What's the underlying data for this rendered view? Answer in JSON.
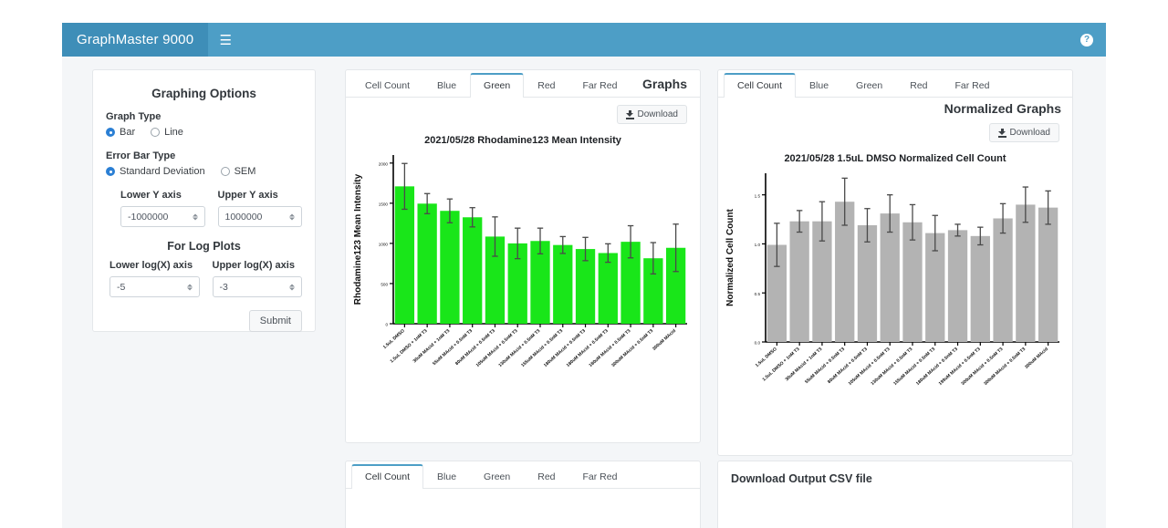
{
  "navbar": {
    "brand": "GraphMaster 9000",
    "menu_icon": "hamburger-icon",
    "help_icon": "?",
    "bg_color": "#4d9ec6",
    "brand_bg_color": "#3e8eb8"
  },
  "options_panel": {
    "title": "Graphing Options",
    "graph_type": {
      "label": "Graph Type",
      "options": [
        "Bar",
        "Line"
      ],
      "selected": "Bar"
    },
    "error_bar_type": {
      "label": "Error Bar Type",
      "options": [
        "Standard Deviation",
        "SEM"
      ],
      "selected": "Standard Deviation"
    },
    "lower_y": {
      "label": "Lower Y axis",
      "value": "-1000000"
    },
    "upper_y": {
      "label": "Upper Y axis",
      "value": "1000000"
    },
    "log_title": "For Log Plots",
    "lower_logx": {
      "label": "Lower log(X) axis",
      "value": "-5"
    },
    "upper_logx": {
      "label": "Upper log(X) axis",
      "value": "-3"
    },
    "submit_label": "Submit"
  },
  "graph_panel": {
    "heading": "Graphs",
    "tabs": [
      "Cell Count",
      "Blue",
      "Green",
      "Red",
      "Far Red"
    ],
    "active_tab": "Green",
    "download_label": "Download"
  },
  "normalized_panel": {
    "heading": "Normalized Graphs",
    "tabs": [
      "Cell Count",
      "Blue",
      "Green",
      "Red",
      "Far Red"
    ],
    "active_tab": "Cell Count",
    "download_label": "Download"
  },
  "bottom_left_panel": {
    "tabs": [
      "Cell Count",
      "Blue",
      "Green",
      "Red",
      "Far Red"
    ],
    "active_tab": "Cell Count"
  },
  "bottom_right_panel": {
    "title": "Download Output CSV file"
  },
  "chart_data": [
    {
      "id": "green-intensity-chart",
      "type": "bar",
      "title": "2021/05/28  Rhodamine123 Mean Intensity",
      "xlabel": "",
      "ylabel": "Rhodamine123 Mean Intensity",
      "ylim": [
        0,
        2100
      ],
      "yticks": [
        0,
        500,
        1000,
        1500,
        2000
      ],
      "ytick_labels": [
        "0",
        "500",
        "1000",
        "1500",
        "2000"
      ],
      "bar_color": "#19e619",
      "error_bar_color": "#4a4a4a",
      "error_bar_type": "Standard Deviation",
      "grid": false,
      "legend": "none",
      "categories": [
        "1.5uL DMSO",
        "1.5uL DMSO + 1nM T3",
        "30uM MAcid + 1nM T3",
        "55uM MAcid + 0.5nM T3",
        "80uM MAcid + 0.5nM T3",
        "105uM MAcid + 0.5nM T3",
        "130uM MAcid + 0.5nM T3",
        "155uM MAcid + 0.5nM T3",
        "180uM MAcid + 0.5nM T3",
        "180uM MAcid + 0.5nM T3",
        "180uM MAcid + 0.5nM T3",
        "300uM MAcid + 0.5nM T3",
        "300uM MAcid"
      ],
      "values": [
        1710,
        1495,
        1405,
        1325,
        1085,
        1000,
        1030,
        980,
        930,
        880,
        1020,
        815,
        945
      ],
      "errors": [
        285,
        125,
        148,
        120,
        245,
        190,
        160,
        105,
        145,
        115,
        200,
        195,
        295
      ]
    },
    {
      "id": "normalized-cell-count-chart",
      "type": "bar",
      "title": "2021/05/28  1.5uL DMSO Normalized Cell Count",
      "xlabel": "",
      "ylabel": "Normalized Cell Count",
      "ylim": [
        0,
        1.72
      ],
      "yticks": [
        0.0,
        0.5,
        1.0,
        1.5
      ],
      "ytick_labels": [
        "0.0",
        "0.5",
        "1.0",
        "1.5"
      ],
      "bar_color": "#b3b3b3",
      "error_bar_color": "#4a4a4a",
      "error_bar_type": "Standard Deviation",
      "grid": false,
      "legend": "none",
      "categories": [
        "1.5uL DMSO",
        "1.5uL DMSO + 1nM T3",
        "30uM MAcid + 1nM T3",
        "55uM MAcid + 0.5nM T3",
        "80uM MAcid + 0.5nM T3",
        "105uM MAcid + 0.5nM T3",
        "130uM MAcid + 0.5nM T3",
        "155uM MAcid + 0.5nM T3",
        "180uM MAcid + 0.5nM T3",
        "199uM MAcid + 0.5nM T3",
        "300uM MAcid + 0.5nM T3",
        "300uM MAcid + 0.5nM T3",
        "300uM MAcid"
      ],
      "values": [
        0.99,
        1.23,
        1.23,
        1.43,
        1.19,
        1.31,
        1.22,
        1.11,
        1.14,
        1.08,
        1.26,
        1.4,
        1.37
      ],
      "errors": [
        0.22,
        0.11,
        0.2,
        0.24,
        0.17,
        0.19,
        0.18,
        0.18,
        0.06,
        0.09,
        0.15,
        0.18,
        0.17
      ]
    }
  ]
}
